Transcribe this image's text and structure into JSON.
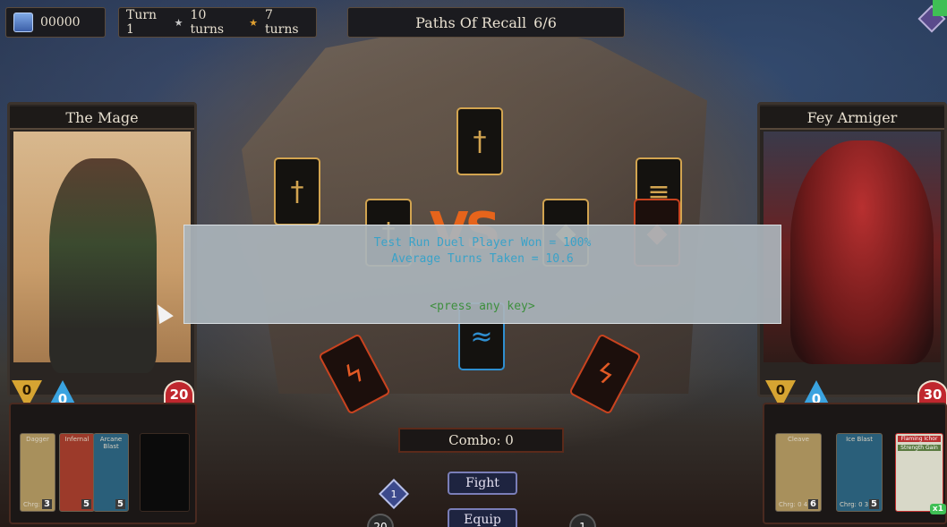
{
  "topbar": {
    "gold": "00000",
    "turn": "Turn 1",
    "silver_turns": "10 turns",
    "gold_turns": "7 turns",
    "title": "Paths Of Recall",
    "progress": "6/6"
  },
  "player": {
    "name": "The Mage",
    "shield": "0",
    "water": "0",
    "health": "20",
    "hand": [
      {
        "title": "Dagger",
        "cost": "Chrg: 0 2",
        "count": "3"
      },
      {
        "title": "Infernal",
        "cost": "",
        "count": "5"
      },
      {
        "title": "Arcane Blast",
        "cost": "",
        "count": "5"
      }
    ]
  },
  "enemy": {
    "name": "Fey Armiger",
    "shield": "0",
    "water": "0",
    "health": "30",
    "hand": [
      {
        "title": "Cleave",
        "cost": "Chrg: 0 4",
        "count": "6"
      },
      {
        "title": "Ice Blast",
        "cost": "Chrg: 0 3",
        "count": "5"
      },
      {
        "title": "Flaming Ichor",
        "subtitle": "Strength Gain",
        "count": "x1"
      }
    ]
  },
  "board": {
    "vs_label": "VS"
  },
  "dialog": {
    "line1": "Test Run Duel Player Won = 100%",
    "line2": "Average Turns Taken = 10.6",
    "prompt": "<press any key>"
  },
  "combo": {
    "label": "Combo: 0"
  },
  "actions": {
    "fight": "Fight",
    "equip": "Equip"
  },
  "badges": {
    "left_diamond": "1",
    "left_round": "20",
    "right_round": "1"
  },
  "colors": {
    "gold_accent": "#d2a450",
    "red_accent": "#c9431f",
    "blue_accent": "#2f8fd0",
    "dialog_text": "#3aa2c8",
    "prompt_text": "#3e8f3e"
  }
}
